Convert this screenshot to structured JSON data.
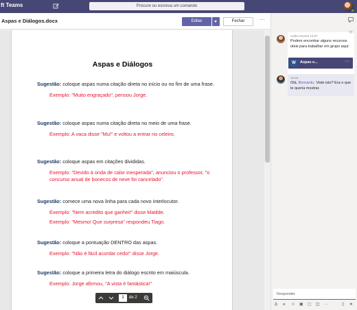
{
  "topbar": {
    "app_title": "ft Teams",
    "search_placeholder": "Procure ou escreva um comando"
  },
  "doc_header": {
    "file_name": "Aspas e Diálogos.docx",
    "edit_label": "Editar",
    "close_label": "Fechar",
    "more": "···"
  },
  "document": {
    "title": "Aspas e Diálogos",
    "suggestion_label": "Sugestão:",
    "blocks": [
      {
        "tip": " coloque aspas numa citação direta no início ou no fim de uma frase.",
        "examples": [
          "Exemplo: \"Muito engraçado\", pensou Jorge."
        ]
      },
      {
        "tip": " coloque aspas numa citação direta no meio de uma frase.",
        "examples": [
          "Exemplo: A vaca disse \"Mu!\" e voltou a entrar no celeiro."
        ]
      },
      {
        "tip": " coloque aspas em citações divididas.",
        "examples": [
          "Exemplo: \"Devido à onda de calor inesperada\", anunciou o professor, \"o concurso anual de bonecos de neve foi cancelado\"."
        ]
      },
      {
        "tip": " comece uma nova linha para cada novo interlocutor.",
        "examples": [
          "Exemplo: \"Nem acredito que ganhei!\" disse Matilde.",
          "Exemplo: \"Mesmo! Que surpresa\" respondeu Tiago."
        ]
      },
      {
        "tip": " coloque a pontuação DENTRO das aspas.",
        "examples": [
          "Exemplo: \"Não é fácil acordar cedo!\" disse Jorge."
        ]
      },
      {
        "tip": " coloque a primeira letra do diálogo escrito em maiúscula.",
        "examples": [
          "Exemplo: Jorge afirmou, \"A vista é fantástica!\""
        ]
      }
    ]
  },
  "pager": {
    "current_page": "1",
    "of_text": "de 2"
  },
  "chat": {
    "message1": {
      "sender": "Carla Amorim",
      "time": "14:07",
      "text": "Podem encontrar alguns recursos úteis para trabalhar em grupo aqui:",
      "file_label": "Aspas e...",
      "file_more": "···"
    },
    "message2": {
      "time": "16:18",
      "text_before": "Olá, ",
      "mention": "Bernardo",
      "text_after": ". Viste isto? Era o que te queria mostrar."
    },
    "reply_placeholder": "Responder"
  },
  "colors": {
    "brand": "#464775",
    "accent": "#6264a7",
    "suggestion": "#1f3864",
    "example": "#e8112d"
  }
}
